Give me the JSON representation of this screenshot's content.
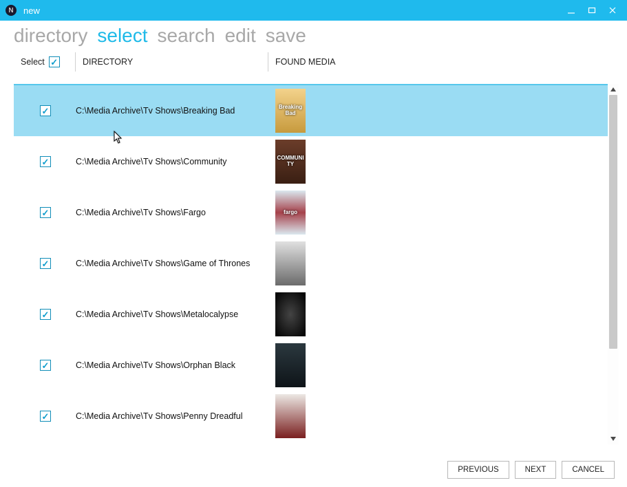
{
  "window": {
    "title": "new"
  },
  "steps": {
    "items": [
      {
        "label": "directory",
        "active": false
      },
      {
        "label": "select",
        "active": true
      },
      {
        "label": "search",
        "active": false
      },
      {
        "label": "edit",
        "active": false
      },
      {
        "label": "save",
        "active": false
      }
    ]
  },
  "columns": {
    "select_label": "Select",
    "directory_label": "DIRECTORY",
    "media_label": "FOUND MEDIA"
  },
  "rows": [
    {
      "checked": true,
      "selected": true,
      "dir": "C:\\Media Archive\\Tv Shows\\Breaking Bad",
      "media": "Breaking Bad"
    },
    {
      "checked": true,
      "selected": false,
      "dir": "C:\\Media Archive\\Tv Shows\\Community",
      "media": "COMMUNITY"
    },
    {
      "checked": true,
      "selected": false,
      "dir": "C:\\Media Archive\\Tv Shows\\Fargo",
      "media": "fargo"
    },
    {
      "checked": true,
      "selected": false,
      "dir": "C:\\Media Archive\\Tv Shows\\Game of Thrones",
      "media": ""
    },
    {
      "checked": true,
      "selected": false,
      "dir": "C:\\Media Archive\\Tv Shows\\Metalocalypse",
      "media": ""
    },
    {
      "checked": true,
      "selected": false,
      "dir": "C:\\Media Archive\\Tv Shows\\Orphan Black",
      "media": ""
    },
    {
      "checked": true,
      "selected": false,
      "dir": "C:\\Media Archive\\Tv Shows\\Penny Dreadful",
      "media": ""
    }
  ],
  "footer": {
    "previous": "PREVIOUS",
    "next": "NEXT",
    "cancel": "CANCEL"
  },
  "header_checked": true
}
